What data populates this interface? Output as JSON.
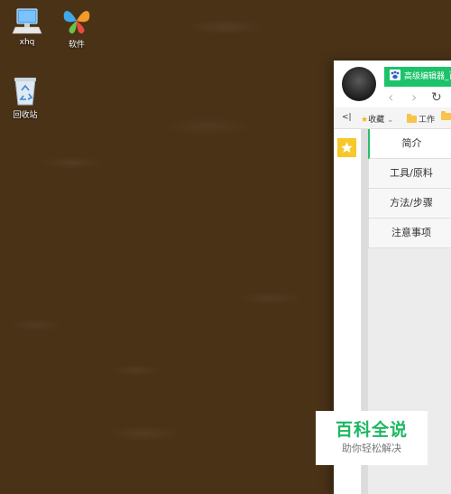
{
  "desktop": {
    "icons": [
      {
        "label": "xhq",
        "icon": "computer-icon"
      },
      {
        "label": "软件",
        "icon": "butterfly-icon"
      },
      {
        "label": "回收站",
        "icon": "recycle-bin-icon"
      }
    ]
  },
  "browser": {
    "tab_title": "高级编辑器_百",
    "bookmarks": {
      "collapse": "<|",
      "favorites": "收藏",
      "folder1": "工作"
    },
    "sidebar_menu": [
      {
        "label": "简介",
        "active": true
      },
      {
        "label": "工具/原料",
        "active": false
      },
      {
        "label": "方法/步骤",
        "active": false
      },
      {
        "label": "注意事项",
        "active": false
      }
    ]
  },
  "watermark": {
    "title": "百科全说",
    "subtitle": "助你轻松解决"
  },
  "colors": {
    "accent": "#1cc36a",
    "desktop_bg": "#4a3217",
    "star_badge": "#f6c82a"
  }
}
